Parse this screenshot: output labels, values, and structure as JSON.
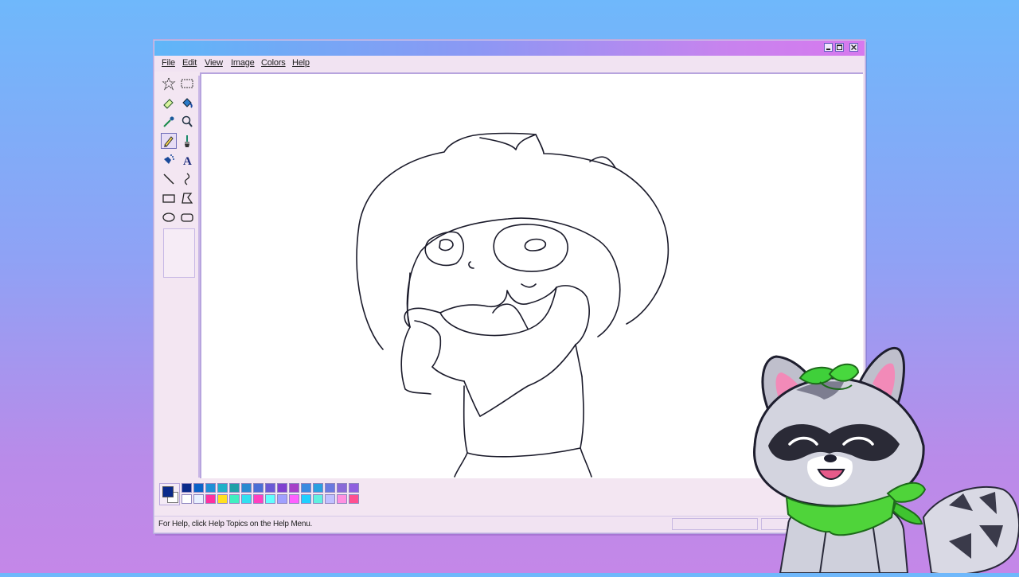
{
  "menu": [
    "File",
    "Edit",
    "View",
    "Image",
    "Colors",
    "Help"
  ],
  "window_controls": {
    "minimize": "_",
    "maximize": "□",
    "close": "x"
  },
  "tools": [
    "free-form-select",
    "rectangle-select",
    "eraser",
    "fill",
    "color-picker",
    "magnifier",
    "pencil",
    "brush",
    "airbrush",
    "text",
    "line",
    "curve",
    "rectangle",
    "polygon",
    "ellipse",
    "rounded-rectangle"
  ],
  "selected_tool": "pencil",
  "palette": {
    "foreground": "#0a2a8a",
    "background": "#ffffff",
    "top_row": [
      "#0a2a8a",
      "#0a62c8",
      "#1f8fd6",
      "#1fb0c8",
      "#1fa0a8",
      "#2a8ad0",
      "#4a6fd6",
      "#6a58d6",
      "#8040d0",
      "#a640c8",
      "#3a8ae0",
      "#2aa0e0",
      "#6a7ae0",
      "#8a6ad8",
      "#9060e0"
    ],
    "bottom_row": [
      "#ffffff",
      "#e8f0ff",
      "#ff30a0",
      "#ffe020",
      "#40f0c0",
      "#30e0f0",
      "#ff40c0",
      "#60ffff",
      "#a0a0ff",
      "#ff60ff",
      "#20d0ff",
      "#60f0e0",
      "#c0c0ff",
      "#ff90e0",
      "#ff5090"
    ]
  },
  "status": {
    "help_text": "For Help, click Help Topics on the Help Menu."
  }
}
